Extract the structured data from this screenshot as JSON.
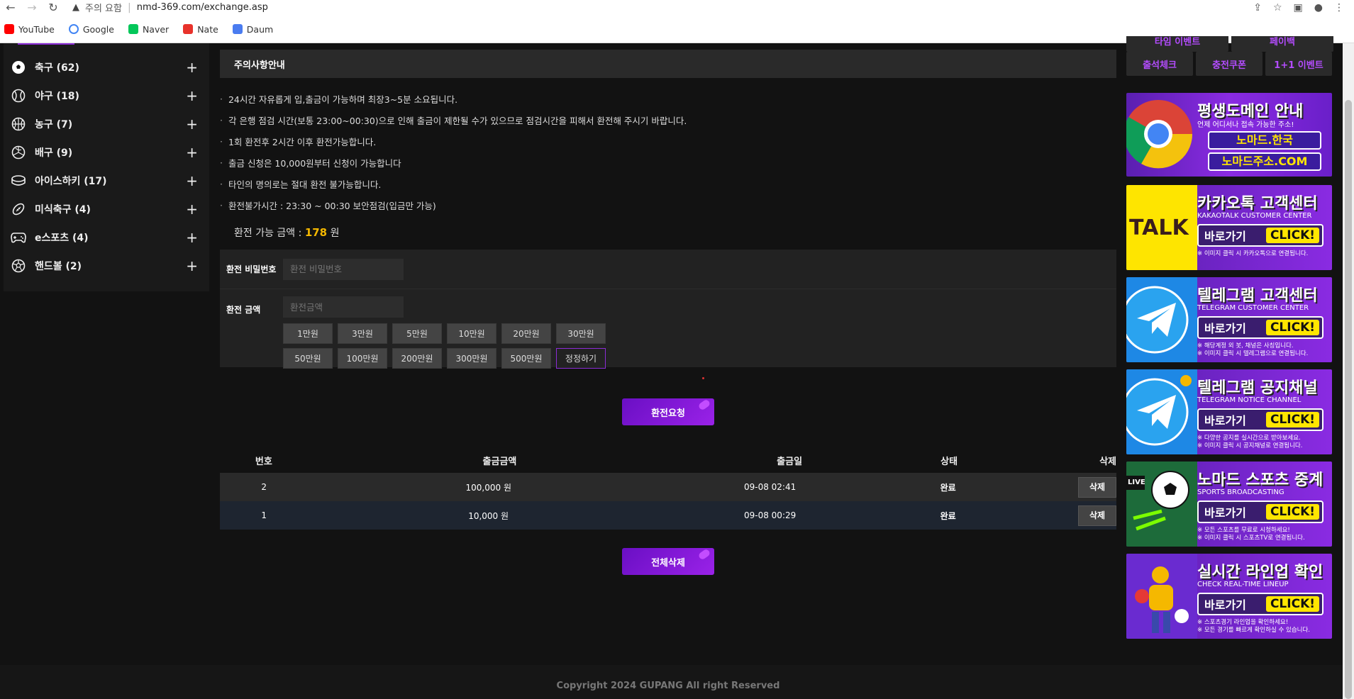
{
  "browser": {
    "warning": "주의 요함",
    "url": "nmd-369.com/exchange.asp",
    "bookmarks": [
      {
        "label": "YouTube",
        "color": "#ff0000"
      },
      {
        "label": "Google",
        "color": "#4285f4"
      },
      {
        "label": "Naver",
        "color": "#03c75a"
      },
      {
        "label": "Nate",
        "color": "#e8322b"
      },
      {
        "label": "Daum",
        "color": "#4a7cf0"
      }
    ]
  },
  "sidebar": {
    "items": [
      {
        "label": "축구 (62)",
        "icon": "soccer-ball-icon"
      },
      {
        "label": "야구 (18)",
        "icon": "baseball-icon"
      },
      {
        "label": "농구 (7)",
        "icon": "basketball-icon"
      },
      {
        "label": "배구 (9)",
        "icon": "volleyball-icon"
      },
      {
        "label": "아이스하키 (17)",
        "icon": "hockey-puck-icon"
      },
      {
        "label": "미식축구 (4)",
        "icon": "football-icon"
      },
      {
        "label": "e스포츠 (4)",
        "icon": "gamepad-icon"
      },
      {
        "label": "핸드볼 (2)",
        "icon": "handball-icon"
      }
    ]
  },
  "notice": {
    "title": "주의사항안내",
    "items": [
      "24시간 자유롭게 입,출금이 가능하며 최장3~5분 소요됩니다.",
      "각 은행 점검 시간(보통 23:00~00:30)으로 인해 출금이 제한될 수가 있으므로 점검시간을 피해서 환전해 주시기 바랍니다.",
      "1회 환전후 2시간 이후 환전가능합니다.",
      "출금 신청은 10,000원부터 신청이 가능합니다",
      "타인의 명의로는 절대 환전 불가능합니다.",
      "환전불가시간 : 23:30 ~ 00:30 보안점검(입금만 가능)"
    ]
  },
  "available": {
    "label": "환전 가능 금액 :",
    "amount": "178",
    "unit": "원"
  },
  "form": {
    "password_label": "환전 비밀번호",
    "password_placeholder": "환전 비밀번호",
    "amount_label": "환전 금액",
    "amount_placeholder": "환전금액",
    "amount_buttons": [
      "1만원",
      "3만원",
      "5만원",
      "10만원",
      "20만원",
      "30만원",
      "50만원",
      "100만원",
      "200만원",
      "300만원",
      "500만원",
      "정정하기"
    ]
  },
  "submit_label": "환전요청",
  "table": {
    "headers": [
      "번호",
      "출금금액",
      "출금일",
      "상태",
      "삭제"
    ],
    "rows": [
      {
        "no": "2",
        "amount": "100,000 원",
        "date": "09-08 02:41",
        "status": "완료",
        "delete": "삭제"
      },
      {
        "no": "1",
        "amount": "10,000 원",
        "date": "09-08 00:29",
        "status": "완료",
        "delete": "삭제"
      }
    ]
  },
  "delete_all_label": "전체삭제",
  "events": {
    "top": [
      "타임 이벤트",
      "페이백"
    ],
    "bottom": [
      "출석체크",
      "충전쿠폰",
      "1+1 이벤트"
    ]
  },
  "banners": [
    {
      "title": "평생도메인 안내",
      "sub": "언제 어디서나 접속 가능한 주소!",
      "line1": "노마드.한국",
      "line2": "노마드주소.COM",
      "icon": "chrome-logo-icon"
    },
    {
      "title": "카카오톡 고객센터",
      "sub": "KAKAOTALK CUSTOMER CENTER",
      "go": "바로가기",
      "click": "CLICK!",
      "note": "※ 이미지 클릭 시 카카오톡으로 연결됩니다.",
      "icon": "kakaotalk-icon"
    },
    {
      "title": "텔레그램 고객센터",
      "sub": "TELEGRAM CUSTOMER CENTER",
      "go": "바로가기",
      "click": "CLICK!",
      "note": "※ 해당계정 외 봇, 채널은 사칭입니다.\n※ 이미지 클릭 시 텔레그램으로 연결됩니다.",
      "icon": "telegram-icon"
    },
    {
      "title": "텔레그램 공지채널",
      "sub": "TELEGRAM NOTICE CHANNEL",
      "go": "바로가기",
      "click": "CLICK!",
      "note": "※ 다양한 공지를 실시간으로 받아보세요.\n※ 이미지 클릭 시 공지채널로 연결됩니다.",
      "icon": "telegram-icon"
    },
    {
      "title": "노마드 스포츠 중계",
      "sub": "SPORTS BROADCASTING",
      "go": "바로가기",
      "click": "CLICK!",
      "note": "※ 모든 스포츠를 무료로 시청하세요!\n※ 이미지 클릭 시 스포츠TV로 연결됩니다.",
      "icon": "live-soccer-icon",
      "badge": "LIVE"
    },
    {
      "title": "실시간 라인업 확인",
      "sub": "CHECK REAL-TIME LINEUP",
      "go": "바로가기",
      "click": "CLICK!",
      "note": "※ 스포츠경기 라인업을 확인하세요!\n※ 모든 경기를 빠르게 확인하실 수 있습니다.",
      "icon": "athletes-icon"
    }
  ],
  "footer": {
    "copyright": "Copyright 2024 GUPANG All right Reserved"
  }
}
